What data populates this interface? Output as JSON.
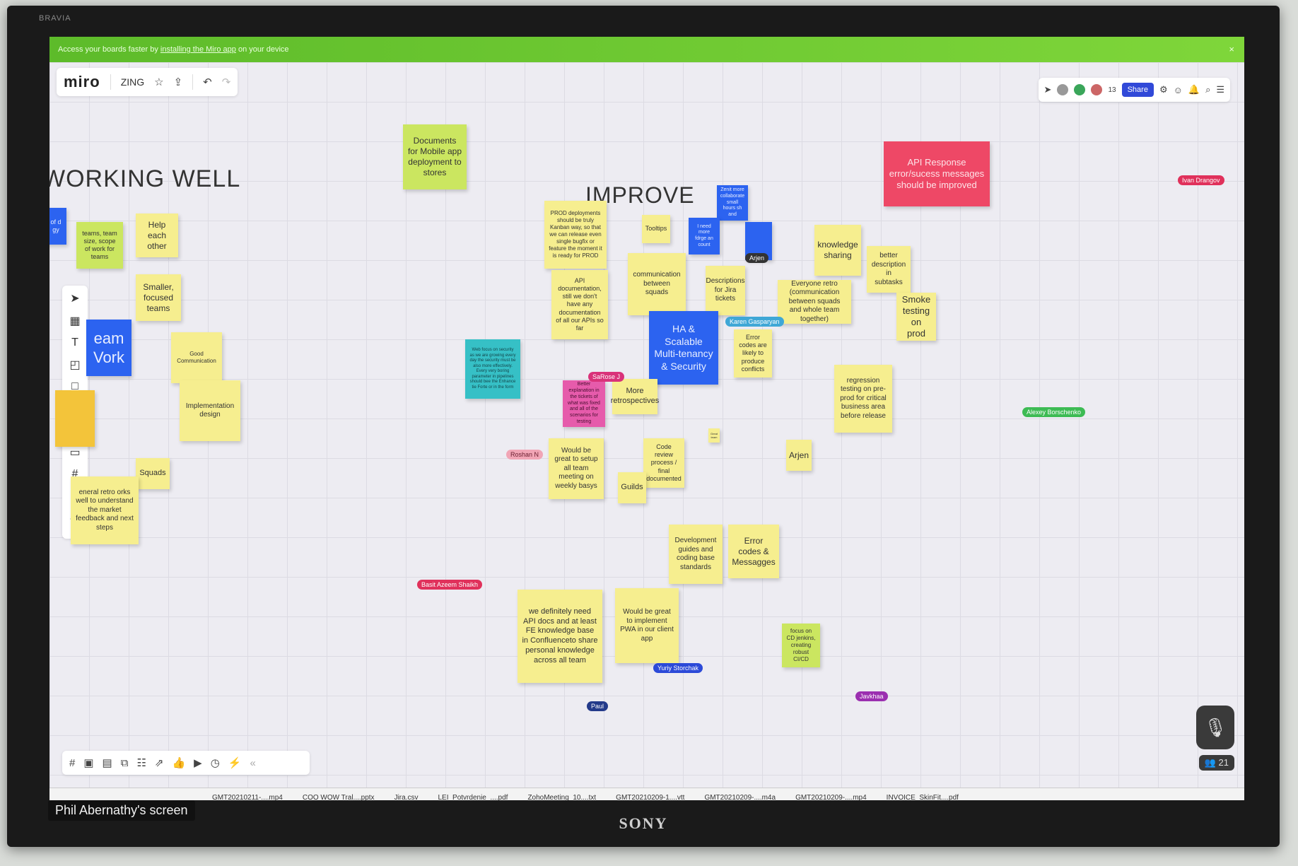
{
  "tv": {
    "top_brand": "BRAVIA",
    "bottom_brand": "SONY"
  },
  "banner": {
    "prefix": "Access your boards faster by",
    "link": "installing the Miro app",
    "suffix": "on your device",
    "close": "×"
  },
  "app": {
    "logo": "miro",
    "board_name": "ZING",
    "star": "☆",
    "upload_icon": "⇪",
    "undo": "↶",
    "redo": "↷"
  },
  "topright": {
    "share": "Share",
    "participants_count": "13"
  },
  "headings": {
    "working_well": "WORKING WELL",
    "improve": "IMPROVE"
  },
  "notes": {
    "docs_mobile": "Documents for Mobile app deployment to stores",
    "api_response": "API Response error/sucess messages should be improved",
    "blue_left": "of d gy",
    "teams_scope": "teams, team size, scope of work for teams",
    "help_each": "Help each other",
    "smaller_teams": "Smaller, focused teams",
    "team_work": "eam Vork",
    "good_comm": "Good Communication",
    "impl_design": "Implementation design",
    "squads": "Squads",
    "general_retro": "eneral retro orks well to understand the market feedback and next steps",
    "prod_deploy": "PROD deployments should be truly Kanban way, so that we can release even single bugfix or feature the moment it is ready for PROD",
    "tooltips": "Tooltips",
    "blue_zenit": "Zenit more collaborate small hours sh and",
    "blue_more_collab": "I need more fdrge an count",
    "comm_squads": "communication between squads",
    "descriptions_jira": "Descriptions for Jira tickets",
    "knowledge_sharing": "knowledge sharing",
    "better_desc": "better description in subtasks",
    "everyone_retro": "Everyone retro (communication between squads and whole team together)",
    "smoke_testing": "Smoke testing on prod",
    "api_docs": "API documentation, still we don't have any documentation of all our APIs so far",
    "ha_scalable": "HA & Scalable Multi-tenancy & Security",
    "error_codes_conflicts": "Error codes are likely to produce conflicts",
    "teal_security": "Web focus on security as we are growing every day the security must be also more effectively. Every very boring parameter in pipelines should bee the Enhance tie Forte or in the form",
    "pink_better": "Better explanation in the tickets of what was fixed and all of the scenarios for testing",
    "more_retros": "More retrospectives",
    "regression": "regression testing on pre-prod for critical business area before release",
    "great_setup": "Would be great to setup all team meeting on weekly basys",
    "code_review": "Code review process / final documented",
    "guilds": "Guilds",
    "small_great": "Great team",
    "arjen": "Arjen",
    "dev_guides": "Development guides and coding base standards",
    "error_messages": "Error codes & Messagges",
    "api_docs_confluence": "we definitely need API docs and at least FE knowledge base in Confluenceto share personal knowledge across all team",
    "pwa": "Would be great to implement PWA in our client app",
    "cicd": "focus on CD jenkins, creating robust CI/CD"
  },
  "cursors": {
    "arjen": "Arjen",
    "karen": "Karen Gasparyan",
    "sarose": "SaRose J",
    "roshan": "Roshan N",
    "basit": "Basit Azeem Shaikh",
    "yuriy": "Yuriy Storchak",
    "paul": "Paul",
    "javkhaa": "Javkhaa",
    "alexey": "Alexey Borschenko",
    "ivan": "Ivan Drangov"
  },
  "participants": "21",
  "downloads": [
    "GMT20210211-....mp4",
    "COO WOW Tral....pptx",
    "Jira.csv",
    "LEI_Potvrdenie_....pdf",
    "ZohoMeeting_10....txt",
    "GMT20210209-1....vtt",
    "GMT20210209-....m4a",
    "GMT20210209-....mp4",
    "INVOICE_SkinFit....pdf"
  ],
  "screen_label": "Phil Abernathy's screen",
  "colors": {
    "banner": "#6ccb2e",
    "share": "#3149d8",
    "yellow": "#f6ee8f",
    "blue": "#2c63f0",
    "red": "#ee4866"
  }
}
